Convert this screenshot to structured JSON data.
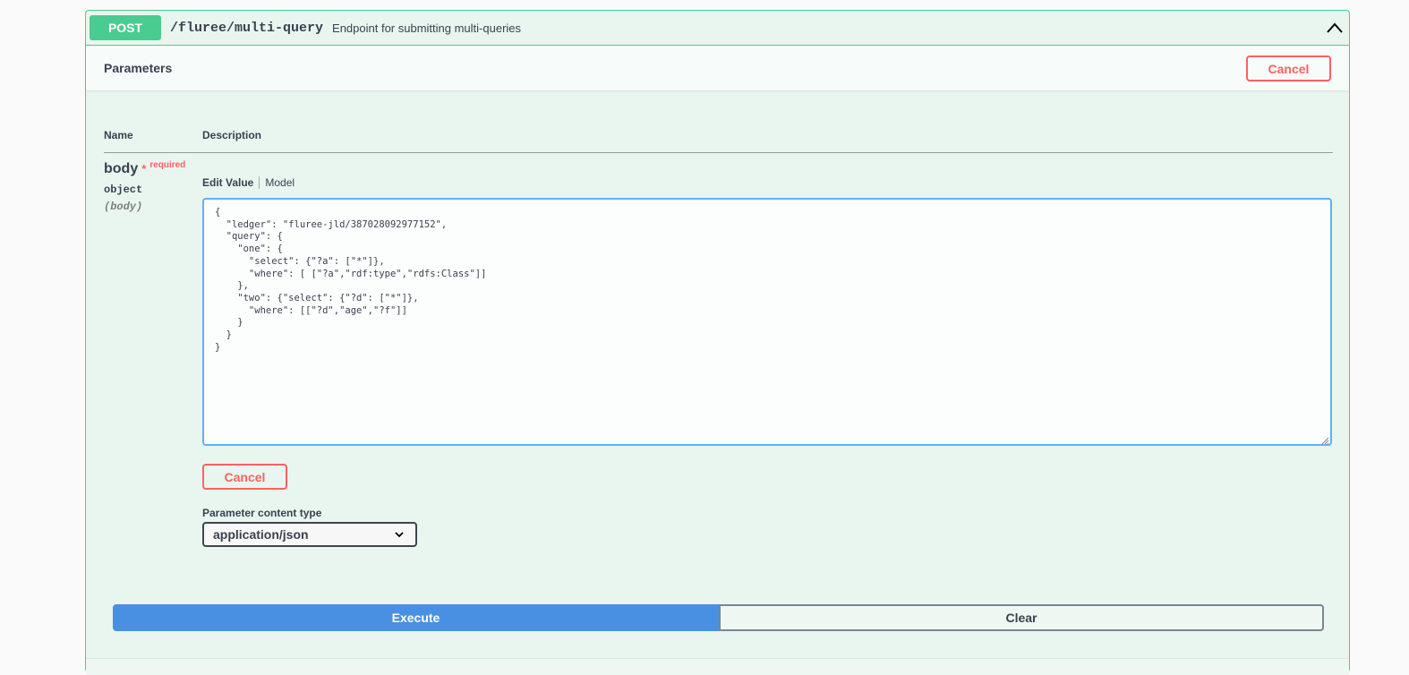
{
  "operation": {
    "method": "POST",
    "path": "/fluree/multi-query",
    "summary": "Endpoint for submitting multi-queries",
    "collapse_icon": "chevron-up-icon"
  },
  "parameters_section": {
    "title": "Parameters",
    "cancel_label": "Cancel",
    "column_name": "Name",
    "column_description": "Description"
  },
  "param": {
    "name": "body",
    "star": "*",
    "required_label": "required",
    "type": "object",
    "in": "(body)",
    "tab_edit_value": "Edit Value",
    "tab_model": "Model",
    "value": "{\n  \"ledger\": \"fluree-jld/387028092977152\",\n  \"query\": {\n    \"one\": {\n      \"select\": {\"?a\": [\"*\"]},\n      \"where\": [ [\"?a\",\"rdf:type\",\"rdfs:Class\"]]\n    },\n    \"two\": {\"select\": {\"?d\": [\"*\"]},\n      \"where\": [[\"?d\",\"age\",\"?f\"]]\n    }\n  }\n}",
    "cancel_label": "Cancel"
  },
  "content_type": {
    "label": "Parameter content type",
    "selected": "application/json",
    "chevron_icon": "chevron-down-icon"
  },
  "actions": {
    "execute_label": "Execute",
    "clear_label": "Clear"
  },
  "colors": {
    "post_green": "#49cc90",
    "cancel_red": "#ff6060",
    "execute_blue": "#4990e2",
    "editor_focus_blue": "#61affe"
  }
}
